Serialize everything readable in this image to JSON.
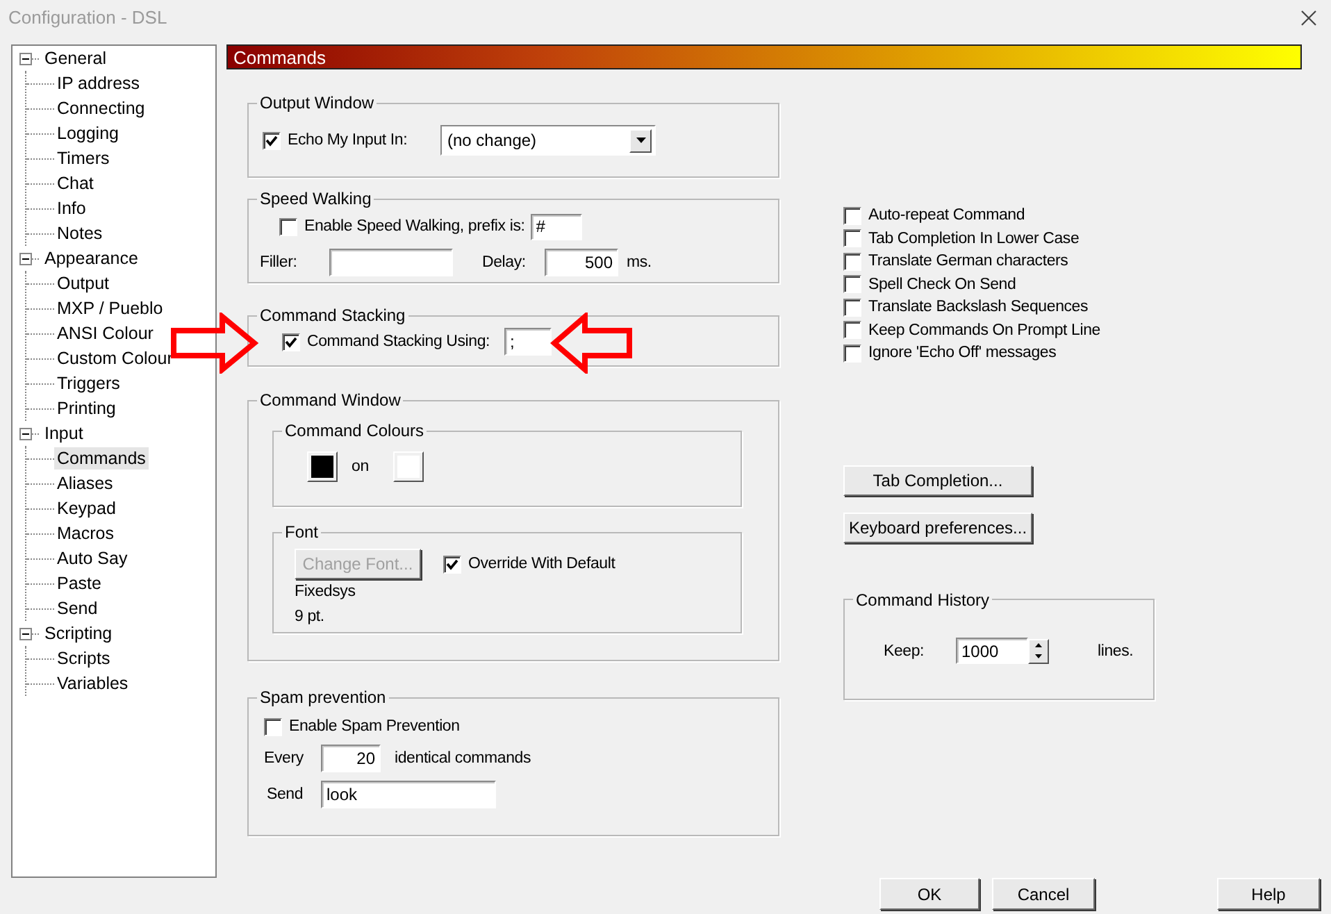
{
  "window": {
    "title": "Configuration - DSL"
  },
  "tree": [
    {
      "label": "General",
      "expanded": true,
      "children": [
        {
          "label": "IP address",
          "selected": false
        },
        {
          "label": "Connecting",
          "selected": false
        },
        {
          "label": "Logging",
          "selected": false
        },
        {
          "label": "Timers",
          "selected": false
        },
        {
          "label": "Chat",
          "selected": false
        },
        {
          "label": "Info",
          "selected": false
        },
        {
          "label": "Notes",
          "selected": false
        }
      ]
    },
    {
      "label": "Appearance",
      "expanded": true,
      "children": [
        {
          "label": "Output",
          "selected": false
        },
        {
          "label": "MXP / Pueblo",
          "selected": false
        },
        {
          "label": "ANSI Colour",
          "selected": false
        },
        {
          "label": "Custom Colour",
          "selected": false
        },
        {
          "label": "Triggers",
          "selected": false
        },
        {
          "label": "Printing",
          "selected": false
        }
      ]
    },
    {
      "label": "Input",
      "expanded": true,
      "children": [
        {
          "label": "Commands",
          "selected": true
        },
        {
          "label": "Aliases",
          "selected": false
        },
        {
          "label": "Keypad",
          "selected": false
        },
        {
          "label": "Macros",
          "selected": false
        },
        {
          "label": "Auto Say",
          "selected": false
        },
        {
          "label": "Paste",
          "selected": false
        },
        {
          "label": "Send",
          "selected": false
        }
      ]
    },
    {
      "label": "Scripting",
      "expanded": true,
      "children": [
        {
          "label": "Scripts",
          "selected": false
        },
        {
          "label": "Variables",
          "selected": false
        }
      ]
    }
  ],
  "page": {
    "title": "Commands"
  },
  "output_window": {
    "title": "Output Window",
    "echo": {
      "label": "Echo My Input In:",
      "checked": true
    },
    "echo_target": {
      "value": "(no change)"
    }
  },
  "speed_walking": {
    "title": "Speed Walking",
    "enable": {
      "label": "Enable Speed Walking, prefix is:",
      "checked": false
    },
    "prefix": {
      "value": "#"
    },
    "filler_label": "Filler:",
    "delay_label": "Delay:",
    "delay": {
      "value": "500"
    },
    "delay_unit": "ms."
  },
  "command_stacking": {
    "title": "Command Stacking",
    "enable": {
      "label": "Command Stacking Using:",
      "checked": true
    },
    "delimiter": {
      "value": ";"
    }
  },
  "command_window": {
    "title": "Command Window",
    "colours": {
      "title": "Command Colours",
      "foreground": {
        "color": "#000000"
      },
      "joiner": "on",
      "background": {
        "color": "#ffffff"
      }
    },
    "font": {
      "title": "Font",
      "change_button": {
        "label": "Change Font...",
        "disabled": true
      },
      "override": {
        "label": "Override With Default",
        "checked": true
      },
      "name": "Fixedsys",
      "size": "9 pt."
    }
  },
  "spam_prevention": {
    "title": "Spam prevention",
    "enable": {
      "label": "Enable Spam Prevention",
      "checked": false
    },
    "every_label": "Every",
    "every": {
      "value": "20"
    },
    "every_suffix": "identical commands",
    "send_label": "Send",
    "send": {
      "value": "look"
    }
  },
  "options": [
    {
      "label": "Auto-repeat Command",
      "checked": false
    },
    {
      "label": "Tab Completion In Lower Case",
      "checked": false
    },
    {
      "label": "Translate German characters",
      "checked": false
    },
    {
      "label": "Spell Check On Send",
      "checked": false
    },
    {
      "label": "Translate Backslash Sequences",
      "checked": false
    },
    {
      "label": "Keep Commands On Prompt Line",
      "checked": false
    },
    {
      "label": "Ignore 'Echo Off' messages",
      "checked": false
    }
  ],
  "buttons": [
    {
      "label": "Tab Completion..."
    },
    {
      "label": "Keyboard preferences..."
    }
  ],
  "command_history": {
    "title": "Command History",
    "keep_label": "Keep:",
    "keep": {
      "value": "1000"
    },
    "unit": "lines."
  },
  "footer_buttons": [
    {
      "label": "OK"
    },
    {
      "label": "Cancel"
    },
    {
      "label": "Help"
    }
  ]
}
